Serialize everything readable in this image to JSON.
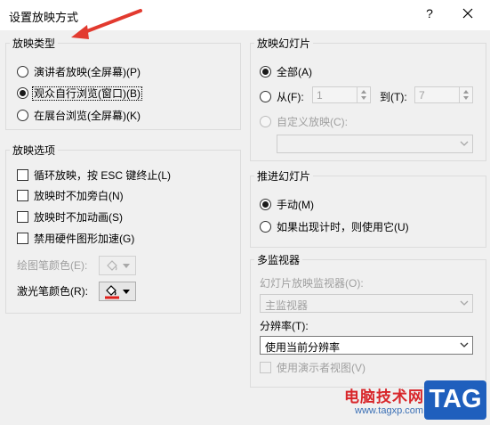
{
  "window": {
    "title": "设置放映方式",
    "help_glyph": "?"
  },
  "show_type": {
    "legend": "放映类型",
    "options": [
      {
        "label": "演讲者放映(全屏幕)(P)",
        "selected": false
      },
      {
        "label": "观众自行浏览(窗口)(B)",
        "selected": true
      },
      {
        "label": "在展台浏览(全屏幕)(K)",
        "selected": false
      }
    ]
  },
  "show_options": {
    "legend": "放映选项",
    "checkboxes": [
      {
        "label": "循环放映，按 ESC 键终止(L)",
        "checked": false
      },
      {
        "label": "放映时不加旁白(N)",
        "checked": false
      },
      {
        "label": "放映时不加动画(S)",
        "checked": false
      },
      {
        "label": "禁用硬件图形加速(G)",
        "checked": false
      }
    ],
    "pen_color_label": "绘图笔颜色(E):",
    "laser_color_label": "激光笔颜色(R):",
    "laser_color": "#e0201c"
  },
  "slides": {
    "legend": "放映幻灯片",
    "all_label": "全部(A)",
    "from_label": "从(F):",
    "from_value": "1",
    "to_label": "到(T):",
    "to_value": "7",
    "custom_label": "自定义放映(C):",
    "custom_value": ""
  },
  "advance": {
    "legend": "推进幻灯片",
    "manual_label": "手动(M)",
    "timings_label": "如果出现计时，则使用它(U)"
  },
  "monitors": {
    "legend": "多监视器",
    "monitor_label": "幻灯片放映监视器(O):",
    "monitor_value": "主监视器",
    "resolution_label": "分辨率(T):",
    "resolution_value": "使用当前分辨率",
    "presenter_view_label": "使用演示者视图(V)"
  },
  "watermark": {
    "site_name": "电脑技术网",
    "url": "www.tagxp.com",
    "tag": "TAG"
  },
  "colors": {
    "annotation_arrow": "#e23a2f",
    "watermark_red": "#d8262a",
    "watermark_blue": "#1f5fbd"
  }
}
